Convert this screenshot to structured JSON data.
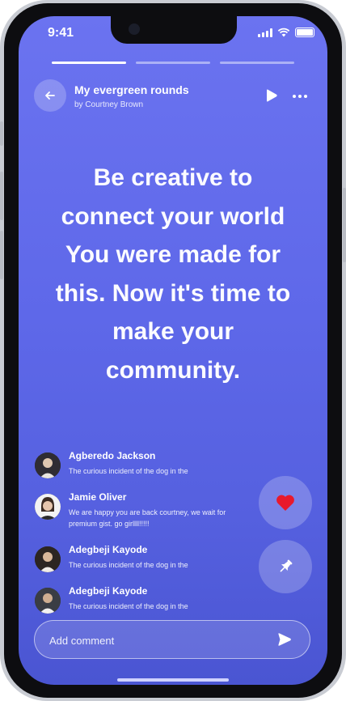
{
  "status_bar": {
    "time": "9:41"
  },
  "story": {
    "progress": [
      1,
      0,
      0
    ],
    "title": "My evergreen rounds",
    "author": "by Courtney Brown",
    "quote": "Be creative to\nconnect your world\nYou were made for\nthis. Now it's time to\nmake your\ncommunity."
  },
  "comments": [
    {
      "name": "Agberedo Jackson",
      "text": "The curious incident of the dog in the"
    },
    {
      "name": "Jamie Oliver",
      "text": "We are happy you are back courtney, we wait for premium gist. go girllll!!!!!"
    },
    {
      "name": "Adegbeji Kayode",
      "text": "The curious incident of the dog in the"
    },
    {
      "name": "Adegbeji Kayode",
      "text": "The curious incident of the dog in the"
    }
  ],
  "comment_input": {
    "placeholder": "Add comment"
  },
  "colors": {
    "background": "#5e68e9",
    "heart": "#e8192c"
  },
  "icons": [
    "back-arrow-icon",
    "play-icon",
    "more-icon",
    "heart-icon",
    "pin-icon",
    "send-icon"
  ]
}
